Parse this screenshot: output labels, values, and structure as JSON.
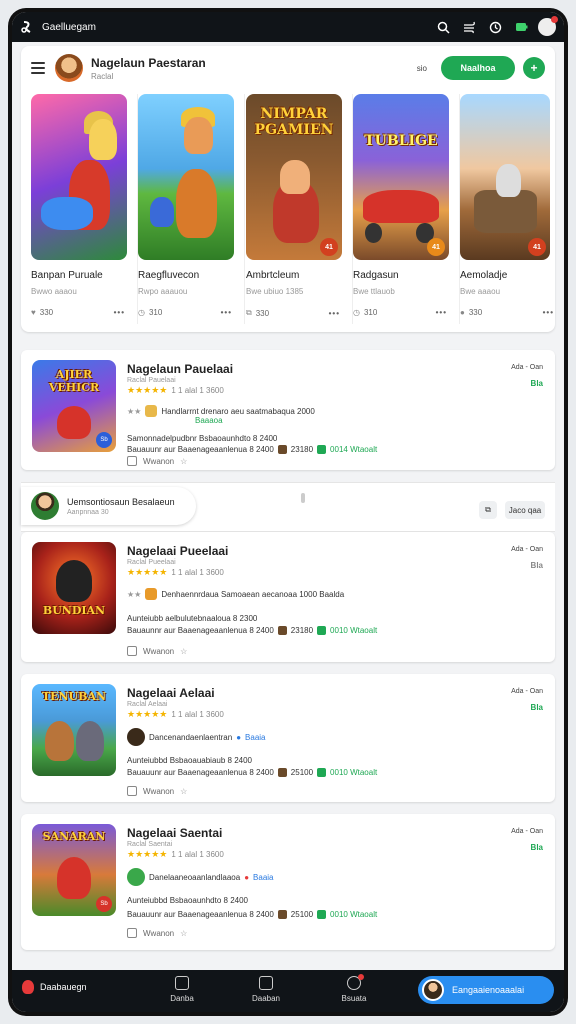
{
  "topbar": {
    "title": "Gaelluegam"
  },
  "featured": {
    "title": "Nagelaun Paestaran",
    "subtitle": "Raclal",
    "small_text": "sio",
    "primary_button": "Naalhoa",
    "games": [
      {
        "name": "Banpan Puruale",
        "meta": "Bwwo aaaou",
        "likes": "330",
        "banner": ""
      },
      {
        "name": "Raegfluvecon",
        "meta": "Rwpo aaauou",
        "likes": "310",
        "banner": ""
      },
      {
        "name": "Ambrtcleum",
        "meta": "Bwe ubiuo 1385",
        "likes": "330",
        "banner": "NIMPAR PGAMIEN",
        "badge": "41"
      },
      {
        "name": "Radgasun",
        "meta": "Bwe ttlauob",
        "likes": "310",
        "banner": "TUBLIGE",
        "badge": "41"
      },
      {
        "name": "Aemoladje",
        "meta": "Bwe aaaou",
        "likes": "330",
        "banner": "",
        "badge": "41"
      }
    ]
  },
  "cards": [
    {
      "title": "Nagelaun Pauelaai",
      "subtitle": "Raclal Pauelaai",
      "rating_count": "1 1 alal 1 3600",
      "line1": "Handlarrnt drenaro aeu saatmabaqua 2000",
      "line1b": "Baaaoa",
      "line2": "Samonnadelpudbnr Bsbaoaunhdto 8 2400",
      "line3": "Bauauunr aur Baaenageaanlenua 8 2400",
      "stat1": "23180",
      "stat2": "0014 Wtaoalt",
      "action": "Wwanon",
      "right_top": "Ada - Oan",
      "right_green": "Bla",
      "thumb_title": "AJIER VEHICR",
      "thumb_badge": "Sb"
    },
    {
      "title": "Nagelaai Pueelaai",
      "subtitle": "Raclal Pueelaai",
      "rating_count": "1 1 alal 1 3600",
      "line1": "Denhaennrdaua Samoaean aecanoaa 1000 Baalda",
      "line2": "Aunteiubb aelbulutebnaaloua 8 2300",
      "line3": "Bauaunnr aur Baaenageaanlenua 8 2400",
      "stat1": "23180",
      "stat2": "0010 Wtaoalt",
      "action": "Wwanon",
      "right_top": "Ada - Oan",
      "right_green": "Bla",
      "thumb_title": "BUNDIAN",
      "thumb_badge": ""
    },
    {
      "title": "Nagelaai Aelaai",
      "subtitle": "Raclal Aelaai",
      "rating_count": "1 1 alal 1 3600",
      "line1": "Dancenandaenlaentran",
      "line1b": "Baaia",
      "line2": "Aunteiubbd Bsbaoauabiaub 8 2400",
      "line3": "Bauauunr aur Baaenageaanlenua 8 2400",
      "stat1": "25100",
      "stat2": "0010 Wtaoalt",
      "action": "Wwanon",
      "right_top": "Ada - Oan",
      "right_green": "Bla",
      "thumb_title": "TENUBAN",
      "thumb_badge": ""
    },
    {
      "title": "Nagelaai Saentai",
      "subtitle": "Raclal Saentai",
      "rating_count": "1 1 alal 1 3600",
      "line1": "Danelaaneoaanlandlaaoa",
      "line1b": "Baaia",
      "line2": "Aunteiubbd Bsbaoaunhdto 8 2400",
      "line3": "Bauauunr aur Baaenageaanlenua 8 2400",
      "stat1": "25100",
      "stat2": "0010 Wtaoalt",
      "action": "Wwanon",
      "right_top": "Ada - Oan",
      "right_green": "Bla",
      "thumb_title": "SANARAN",
      "thumb_badge": "Sb"
    }
  ],
  "comment_strip": {
    "name": "Uemsontiosaun Besalaeun",
    "sub": "Aanpnnaa 30",
    "btn_a": "",
    "btn_b": "Jaco qaa"
  },
  "bottombar": {
    "brand": "Daabauegn",
    "items": [
      "Danba",
      "Daaban",
      "Bsuata"
    ],
    "cta": "Eangaaienoaaalai"
  },
  "colors": {
    "accent_green": "#1fa854",
    "cta_blue": "#2a8ef0",
    "dark_bar": "#101418"
  }
}
